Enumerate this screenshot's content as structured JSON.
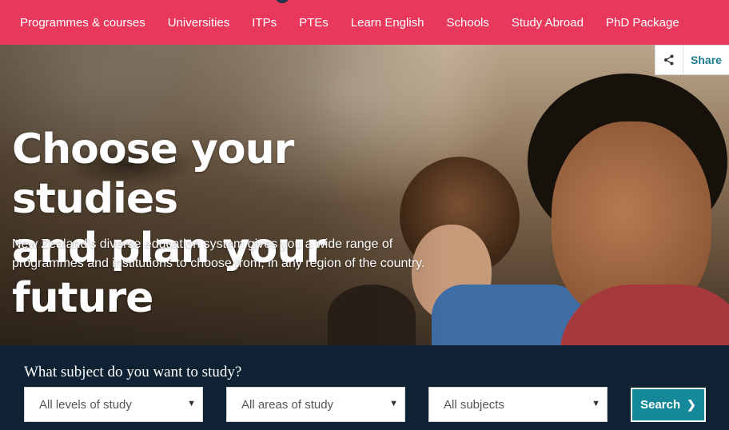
{
  "nav": {
    "items": [
      {
        "label": "Programmes & courses"
      },
      {
        "label": "Universities"
      },
      {
        "label": "ITPs"
      },
      {
        "label": "PTEs"
      },
      {
        "label": "Learn English"
      },
      {
        "label": "Schools"
      },
      {
        "label": "Study Abroad"
      },
      {
        "label": "PhD Package"
      }
    ]
  },
  "share": {
    "icon": "share-icon",
    "label": "Share"
  },
  "hero": {
    "title_line1": "Choose your studies",
    "title_line2": "and plan your future",
    "description": "New Zealand's diverse education system gives you a wide range of programmes and institutions to choose from, in any region of the country."
  },
  "search": {
    "heading": "What subject do you want to study?",
    "level_select": "All levels of study",
    "area_select": "All areas of study",
    "subject_select": "All subjects",
    "button_label": "Search",
    "button_icon": "chevron-right-icon"
  },
  "colors": {
    "nav_bg": "#e8395c",
    "panel_bg": "#0f2233",
    "accent": "#15899a"
  }
}
